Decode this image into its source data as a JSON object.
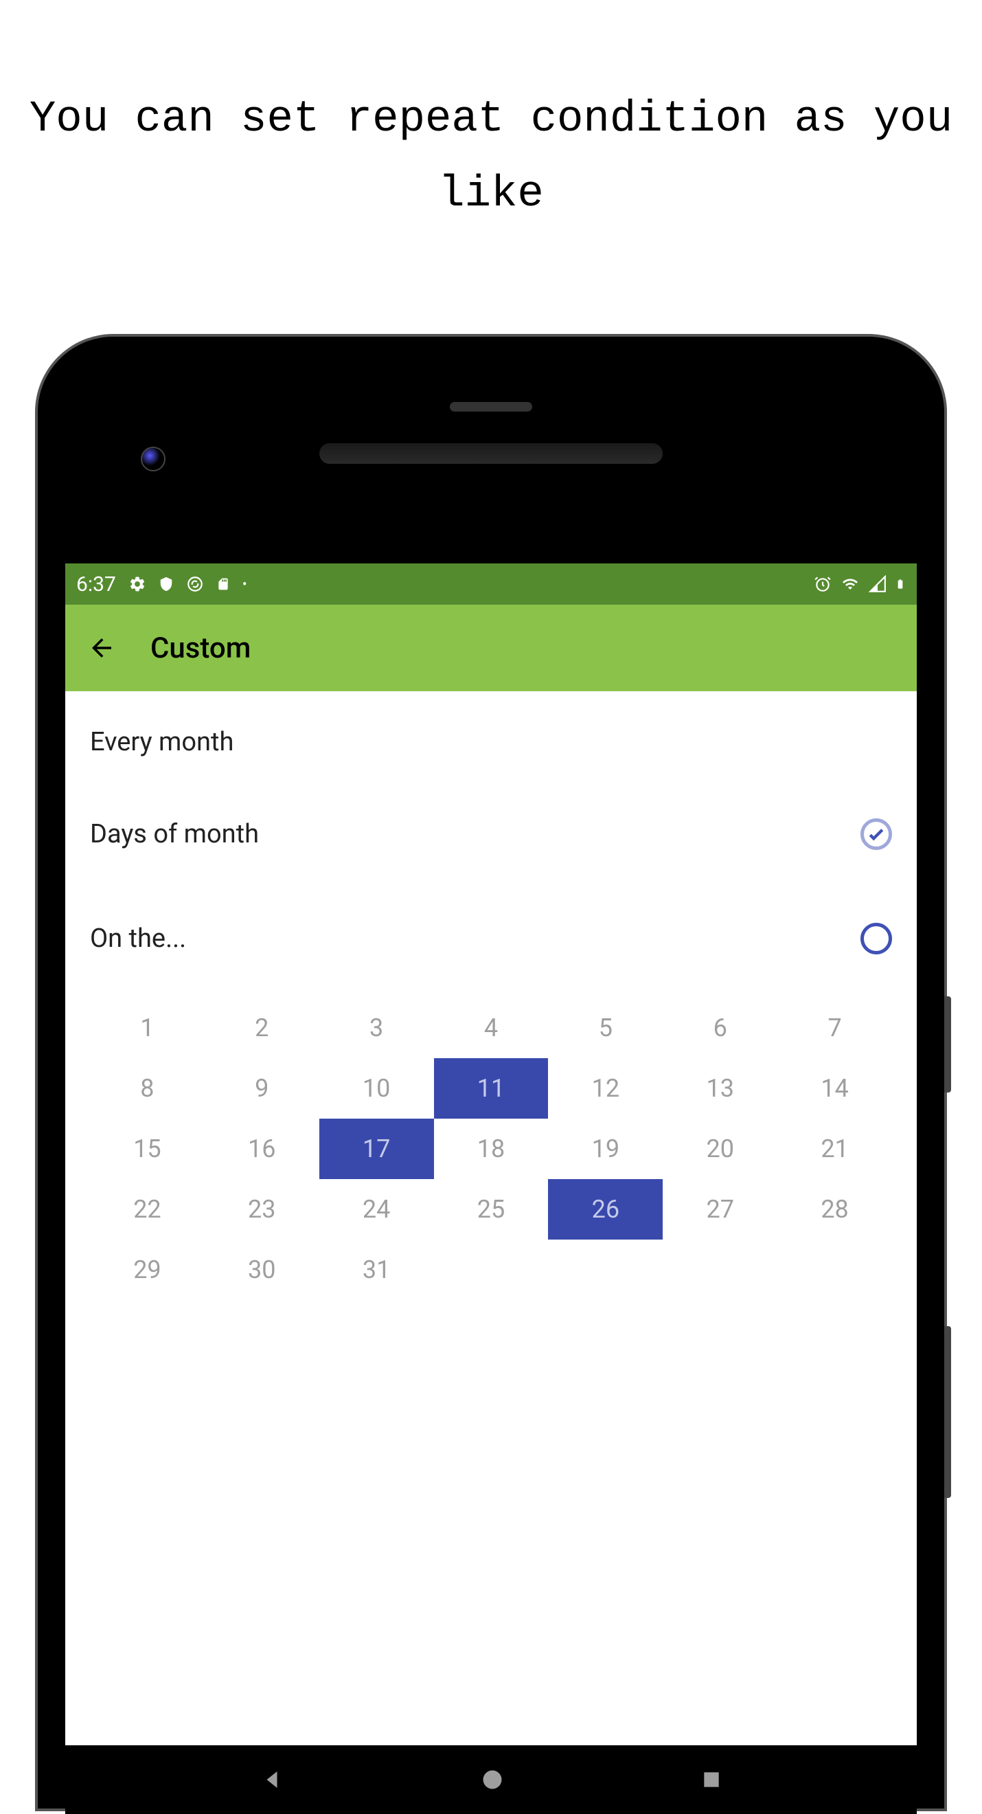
{
  "caption": "You can set repeat condition as you like",
  "statusBar": {
    "time": "6:37"
  },
  "appBar": {
    "title": "Custom"
  },
  "options": {
    "everyMonth": "Every month",
    "daysOfMonth": "Days of month",
    "onThe": "On the...",
    "selectedOption": "daysOfMonth"
  },
  "calendar": {
    "days": [
      1,
      2,
      3,
      4,
      5,
      6,
      7,
      8,
      9,
      10,
      11,
      12,
      13,
      14,
      15,
      16,
      17,
      18,
      19,
      20,
      21,
      22,
      23,
      24,
      25,
      26,
      27,
      28,
      29,
      30,
      31
    ],
    "selectedDays": [
      11,
      17,
      26
    ]
  }
}
